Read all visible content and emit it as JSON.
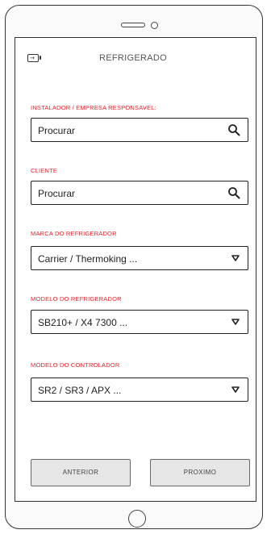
{
  "header": {
    "title": "REFRIGERADO"
  },
  "form": {
    "installer": {
      "label": "INSTALADOR / EMPRESA RESPONSAVEL:",
      "value": "Procurar"
    },
    "client": {
      "label": "CLIENTE",
      "value": "Procurar"
    },
    "brand": {
      "label": "MARCA DO REFRIGERADOR",
      "selected": "Carrier / Thermoking ..."
    },
    "model": {
      "label": "MODELO DO REFRIGERADOR",
      "selected": "SB210+ / X4 7300 ..."
    },
    "controller": {
      "label": "MODELO DO CONTROLADOR",
      "selected": "SR2 / SR3 / APX ..."
    }
  },
  "footer": {
    "prev_label": "ANTERIOR",
    "next_label": "PROXIMO"
  },
  "colors": {
    "label": "#e8222a",
    "button_bg": "#e6e6e6",
    "border": "#222222"
  },
  "icons": {
    "back": "back-icon",
    "search": "search-icon",
    "dropdown": "caret-down-icon"
  }
}
